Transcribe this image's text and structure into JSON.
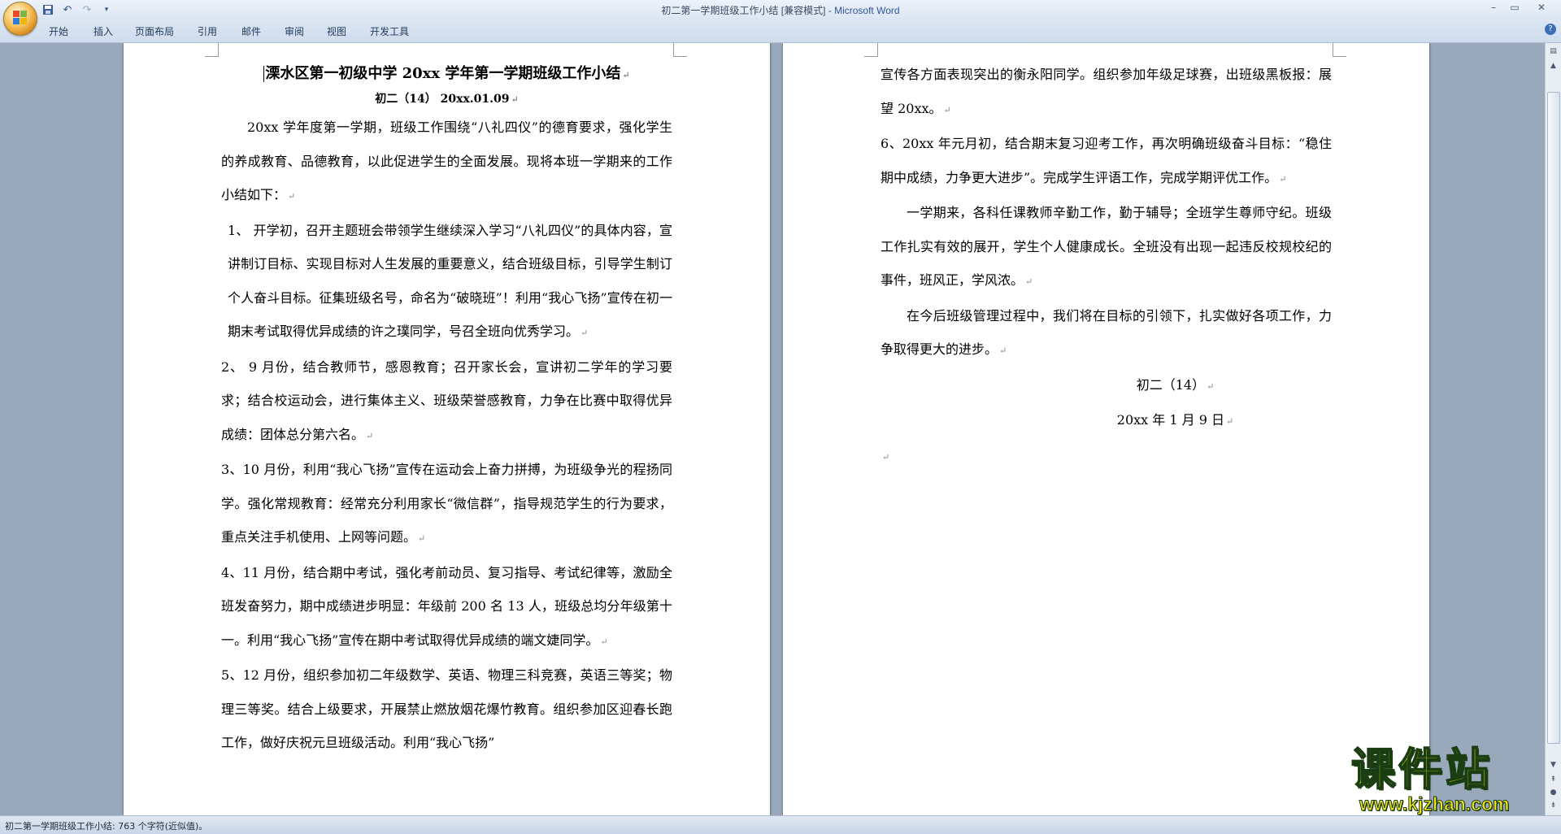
{
  "window": {
    "title_doc": "初二第一学期班级工作小结 [兼容模式] - ",
    "title_app": "Microsoft Word",
    "minimize_icon": "minimize-icon",
    "maximize_icon": "maximize-icon",
    "close_icon": "close-icon"
  },
  "quick_access": {
    "save_icon": "save-icon",
    "undo_icon": "undo-icon",
    "redo_icon": "redo-icon",
    "customize_icon": "dropdown-arrow-icon"
  },
  "ribbon": {
    "tabs": [
      "开始",
      "插入",
      "页面布局",
      "引用",
      "邮件",
      "审阅",
      "视图",
      "开发工具"
    ]
  },
  "document": {
    "page1": {
      "title": "溧水区第一初级中学 20xx 学年第一学期班级工作小结",
      "subtitle": "初二（14）  20xx.01.09",
      "paragraphs": [
        "20xx 学年度第一学期，班级工作围绕“八礼四仪”的德育要求，强化学生的养成教育、品德教育，以此促进学生的全面发展。现将本班一学期来的工作小结如下：",
        "1、  开学初，召开主题班会带领学生继续深入学习“八礼四仪”的具体内容，宣讲制订目标、实现目标对人生发展的重要意义，结合班级目标，引导学生制订个人奋斗目标。征集班级名号，命名为“破晓班”！利用“我心飞扬”宣传在初一期末考试取得优异成绩的许之璞同学，号召全班向优秀学习。",
        "2、 9 月份，结合教师节，感恩教育；召开家长会，宣讲初二学年的学习要求；结合校运动会，进行集体主义、班级荣誉感教育，力争在比赛中取得优异成绩：团体总分第六名。",
        "3、10 月份，利用“我心飞扬”宣传在运动会上奋力拼搏，为班级争光的程扬同学。强化常规教育：经常充分利用家长“微信群”，指导规范学生的行为要求，重点关注手机使用、上网等问题。",
        "4、11 月份，结合期中考试，强化考前动员、复习指导、考试纪律等，激励全班发奋努力，期中成绩进步明显：年级前 200 名 13 人，班级总均分年级第十一。利用“我心飞扬”宣传在期中考试取得优异成绩的端文婕同学。",
        "5、12 月份，组织参加初二年级数学、英语、物理三科竞赛，英语三等奖；物理三等奖。结合上级要求，开展禁止燃放烟花爆竹教育。组织参加区迎春长跑工作，做好庆祝元旦班级活动。利用“我心飞扬”"
      ]
    },
    "page2": {
      "paragraphs": [
        "宣传各方面表现突出的衡永阳同学。组织参加年级足球赛，出班级黑板报：展望 20xx。",
        "6、20xx 年元月初，结合期末复习迎考工作，再次明确班级奋斗目标：“稳住期中成绩，力争更大进步”。完成学生评语工作，完成学期评优工作。",
        "一学期来，各科任课教师辛勤工作，勤于辅导；全班学生尊师守纪。班级工作扎实有效的展开，学生个人健康成长。全班没有出现一起违反校规校纪的事件，班风正，学风浓。",
        "在今后班级管理过程中，我们将在目标的引领下，扎实做好各项工作，力争取得更大的进步。"
      ],
      "signature_class": "初二（14）",
      "signature_date": "20xx 年 1 月 9 日"
    },
    "paragraph_mark": "↵"
  },
  "statusbar": {
    "text": "初二第一学期班级工作小结: 763 个字符(近似值)。"
  },
  "watermark": {
    "main": "课件站",
    "url": "www.kjzhan.com"
  },
  "colors": {
    "title_app": "#2f5597",
    "watermark_fill": "#f7e51b",
    "watermark_stroke": "#1a3d12"
  }
}
